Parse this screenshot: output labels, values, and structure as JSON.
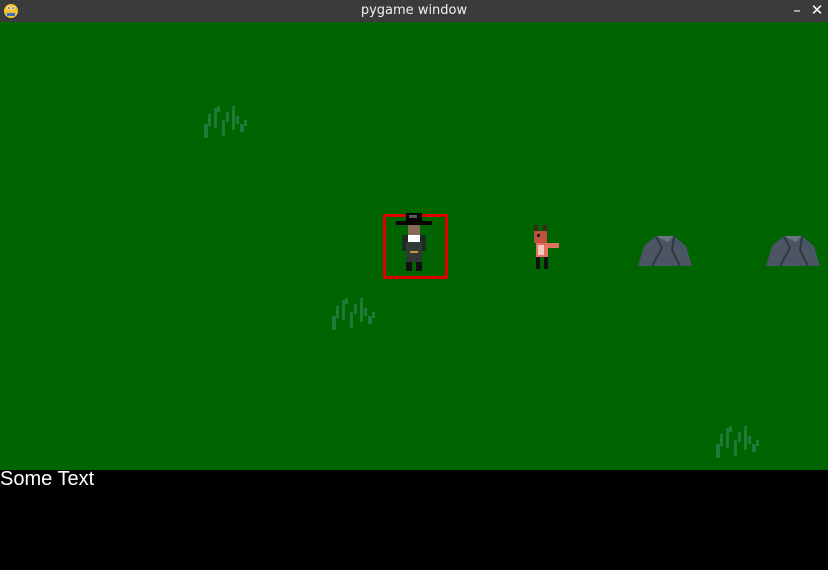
{
  "window": {
    "title": "pygame window",
    "minimize_glyph": "–",
    "close_glyph": "✕"
  },
  "scene": {
    "background_color": "#006400",
    "selection_color": "#e00000",
    "entities": [
      {
        "kind": "player-character",
        "description": "wizard with black hat",
        "selected": true
      },
      {
        "kind": "npc",
        "description": "small red fox/imp creature"
      },
      {
        "kind": "rock",
        "description": "grey boulder"
      },
      {
        "kind": "rock",
        "description": "grey boulder"
      },
      {
        "kind": "grass",
        "description": "tuft of grass"
      },
      {
        "kind": "grass",
        "description": "tuft of grass"
      },
      {
        "kind": "grass",
        "description": "tuft of grass"
      }
    ]
  },
  "hud": {
    "text": "Some Text",
    "background_color": "#000000"
  }
}
